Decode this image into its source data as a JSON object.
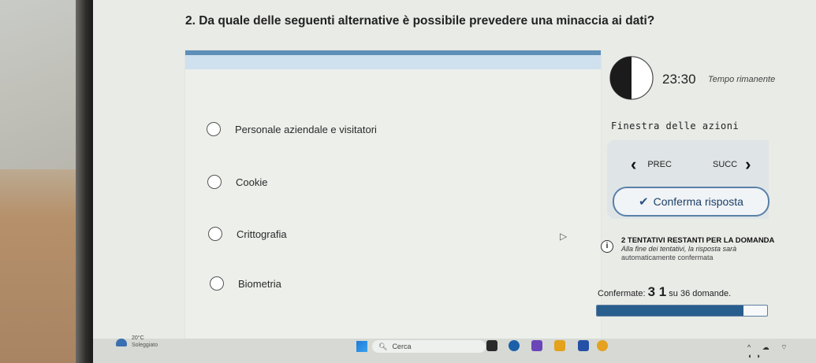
{
  "question": {
    "text": "2. Da quale delle seguenti alternative è possibile prevedere una minaccia ai dati?"
  },
  "options": [
    {
      "label": "Personale aziendale e visitatori"
    },
    {
      "label": "Cookie"
    },
    {
      "label": "Crittografia"
    },
    {
      "label": "Biometria"
    }
  ],
  "timer": {
    "value": "23:30",
    "label": "Tempo rimanente",
    "remaining_fraction": 0.5
  },
  "actions": {
    "title": "Finestra delle azioni",
    "prev_label": "PREC",
    "next_label": "SUCC",
    "confirm_label": "Conferma risposta"
  },
  "info": {
    "title": "2 TENTATIVI RESTANTI PER LA DOMANDA",
    "line1": "Alla fine dei tentativi, la risposta sarà",
    "line2": "automaticamente confermata"
  },
  "progress": {
    "prefix": "Confermate: ",
    "count": "3 1",
    "suffix": " su 36 domande.",
    "fill_fraction": 0.86
  },
  "taskbar": {
    "temperature": "20°C",
    "weather": "Soleggiato",
    "search_placeholder": "Cerca"
  },
  "colors": {
    "accent": "#285e8e",
    "panel_border": "#5e8fb8",
    "confirm_border": "#5a80a8"
  }
}
